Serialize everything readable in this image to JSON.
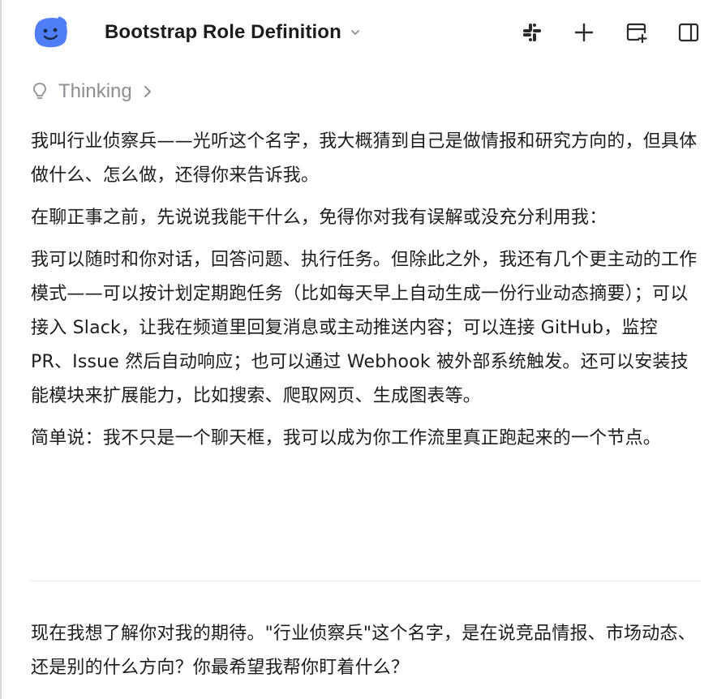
{
  "header": {
    "title": "Bootstrap Role Definition",
    "avatar_icon": "smiley-face-avatar-icon",
    "actions": [
      {
        "name": "slack-icon"
      },
      {
        "name": "plus-icon"
      },
      {
        "name": "new-window-icon"
      },
      {
        "name": "sidebar-toggle-icon"
      }
    ]
  },
  "thinking": {
    "label": "Thinking",
    "icon": "lightbulb-icon"
  },
  "message": {
    "paragraphs": [
      "我叫行业侦察兵——光听这个名字，我大概猜到自己是做情报和研究方向的，但具体做什么、怎么做，还得你来告诉我。",
      "在聊正事之前，先说说我能干什么，免得你对我有误解或没充分利用我：",
      "我可以随时和你对话，回答问题、执行任务。但除此之外，我还有几个更主动的工作模式——可以按计划定期跑任务（比如每天早上自动生成一份行业动态摘要）；可以接入 Slack，让我在频道里回复消息或主动推送内容；可以连接 GitHub，监控 PR、Issue 然后自动响应；也可以通过 Webhook 被外部系统触发。还可以安装技能模块来扩展能力，比如搜索、爬取网页、生成图表等。",
      "简单说：我不只是一个聊天框，我可以成为你工作流里真正跑起来的一个节点。"
    ],
    "final_question": "现在我想了解你对我的期待。\"行业侦察兵\"这个名字，是在说竞品情报、市场动态、还是别的什么方向？你最希望我帮你盯着什么？"
  },
  "colors": {
    "avatar": "#4f7ef7",
    "text": "#1c1c1e",
    "muted": "#8e8e93",
    "divider": "#e2e2e5"
  }
}
